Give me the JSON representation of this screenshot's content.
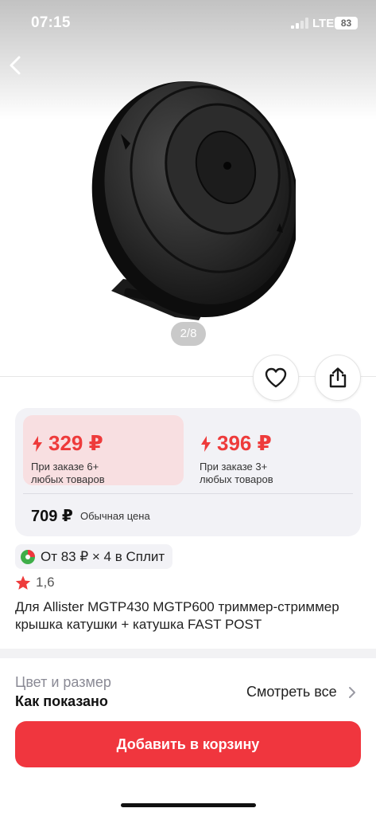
{
  "status_bar": {
    "time": "07:15",
    "network": "LTE",
    "battery": "83"
  },
  "gallery": {
    "counter": "2/8",
    "icons": [
      "back-chevron-icon",
      "heart-icon",
      "share-icon"
    ]
  },
  "pricing": {
    "tiers": [
      {
        "price": "329 ₽",
        "description": "При заказе 6+\nлюбых товаров"
      },
      {
        "price": "396 ₽",
        "description": "При заказе 3+\nлюбых товаров"
      }
    ],
    "regular_price": "709 ₽",
    "regular_label": "Обычная цена"
  },
  "split": {
    "text": "От 83 ₽ × 4 в Сплит"
  },
  "rating": {
    "value": "1,6"
  },
  "product": {
    "title": "Для Allister MGTP430 MGTP600 триммер-стриммер крышка катушки + катушка FAST POST"
  },
  "variant": {
    "label": "Цвет и размер",
    "value": "Как показано",
    "see_all": "Смотреть все"
  },
  "cart": {
    "button_label": "Добавить в корзину"
  },
  "colors": {
    "accent": "#f0363e",
    "price_red": "#ee3b3b",
    "tier_highlight": "#f8dfe1",
    "card_bg": "#f2f2f6"
  }
}
